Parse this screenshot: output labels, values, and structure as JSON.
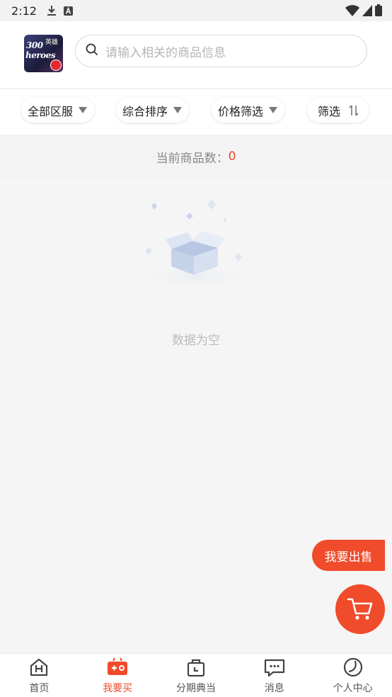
{
  "status_bar": {
    "time": "2:12"
  },
  "header": {
    "logo_text_line1": "300",
    "logo_text_line2": "heroes",
    "logo_text_cn": "英雄",
    "search_placeholder": "请输入相关的商品信息"
  },
  "filters": [
    {
      "label": "全部区服",
      "icon": "triangle-down-icon"
    },
    {
      "label": "综合排序",
      "icon": "triangle-down-icon"
    },
    {
      "label": "价格筛选",
      "icon": "triangle-down-icon"
    },
    {
      "label": "筛选",
      "icon": "sort-arrows-icon"
    }
  ],
  "product_count": {
    "label": "当前商品数：",
    "value": "0"
  },
  "empty_state": {
    "text": "数据为空",
    "icon": "empty-box-icon"
  },
  "floating": {
    "sell_label": "我要出售",
    "cart_icon": "cart-icon"
  },
  "tabbar": [
    {
      "label": "首页",
      "icon": "home-icon",
      "active": false
    },
    {
      "label": "我要买",
      "icon": "gamepad-icon",
      "active": true
    },
    {
      "label": "分期典当",
      "icon": "bag-icon",
      "active": false
    },
    {
      "label": "消息",
      "icon": "message-icon",
      "active": false
    },
    {
      "label": "个人中心",
      "icon": "leaf-icon",
      "active": false
    }
  ],
  "colors": {
    "accent": "#f04b2a",
    "muted": "#bbbbbb"
  }
}
